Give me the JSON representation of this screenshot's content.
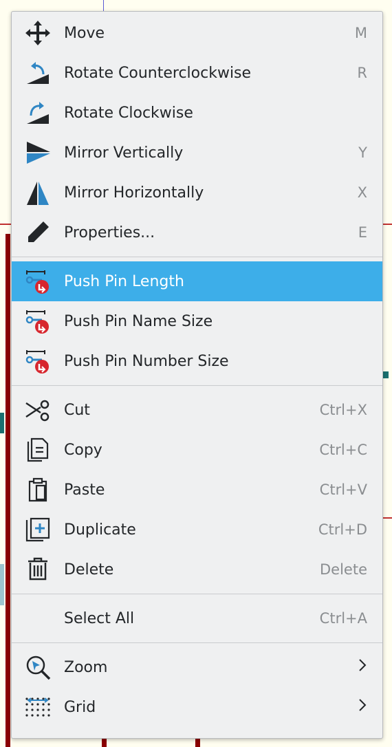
{
  "colors": {
    "accent": "#3daee9",
    "text": "#232629",
    "shortcut": "#8a8d90",
    "icon_dark": "#232629",
    "icon_blue": "#2f86c4",
    "icon_red": "#d7262e"
  },
  "menu": {
    "groups": [
      [
        {
          "label": "Move",
          "shortcut": "M",
          "icon": "move-icon"
        },
        {
          "label": "Rotate Counterclockwise",
          "shortcut": "R",
          "icon": "rotate-ccw-icon"
        },
        {
          "label": "Rotate Clockwise",
          "shortcut": "",
          "icon": "rotate-cw-icon"
        },
        {
          "label": "Mirror Vertically",
          "shortcut": "Y",
          "icon": "mirror-vertical-icon"
        },
        {
          "label": "Mirror Horizontally",
          "shortcut": "X",
          "icon": "mirror-horizontal-icon"
        },
        {
          "label": "Properties...",
          "shortcut": "E",
          "icon": "pencil-icon"
        }
      ],
      [
        {
          "label": "Push Pin Length",
          "shortcut": "",
          "icon": "push-pin-length-icon",
          "selected": true
        },
        {
          "label": "Push Pin Name Size",
          "shortcut": "",
          "icon": "push-pin-name-size-icon"
        },
        {
          "label": "Push Pin Number Size",
          "shortcut": "",
          "icon": "push-pin-number-size-icon"
        }
      ],
      [
        {
          "label": "Cut",
          "shortcut": "Ctrl+X",
          "icon": "scissors-icon"
        },
        {
          "label": "Copy",
          "shortcut": "Ctrl+C",
          "icon": "copy-icon"
        },
        {
          "label": "Paste",
          "shortcut": "Ctrl+V",
          "icon": "paste-icon"
        },
        {
          "label": "Duplicate",
          "shortcut": "Ctrl+D",
          "icon": "duplicate-icon"
        },
        {
          "label": "Delete",
          "shortcut": "Delete",
          "icon": "trash-icon"
        }
      ],
      [
        {
          "label": "Select All",
          "shortcut": "Ctrl+A",
          "icon": ""
        }
      ],
      [
        {
          "label": "Zoom",
          "shortcut": "",
          "icon": "zoom-icon",
          "submenu": true
        },
        {
          "label": "Grid",
          "shortcut": "",
          "icon": "grid-icon",
          "submenu": true
        }
      ]
    ]
  }
}
